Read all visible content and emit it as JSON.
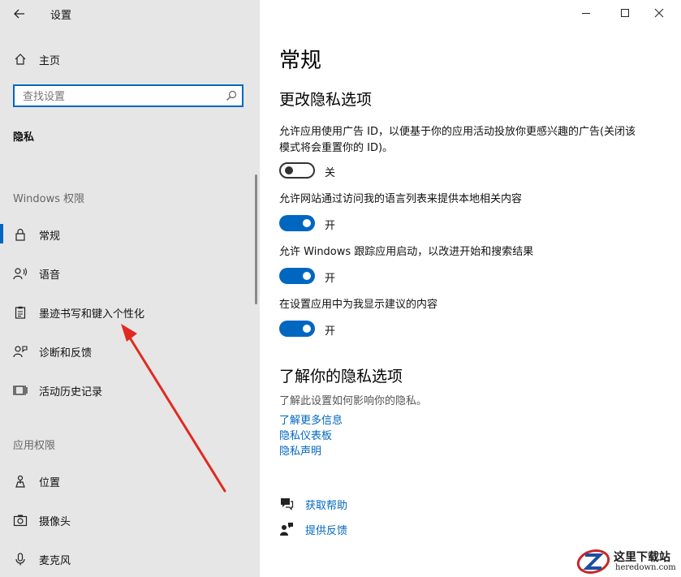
{
  "window": {
    "title": "设置"
  },
  "sidebar": {
    "home_label": "主页",
    "search": {
      "placeholder": "查找设置",
      "value": ""
    },
    "category_title": "隐私",
    "groups": [
      {
        "header": "Windows 权限",
        "items": [
          {
            "label": "常规",
            "icon": "lock-icon",
            "active": true
          },
          {
            "label": "语音",
            "icon": "speech-icon"
          },
          {
            "label": "墨迹书写和键入个性化",
            "icon": "clipboard-icon"
          },
          {
            "label": "诊断和反馈",
            "icon": "feedback-person-icon"
          },
          {
            "label": "活动历史记录",
            "icon": "timeline-icon"
          }
        ]
      },
      {
        "header": "应用权限",
        "items": [
          {
            "label": "位置",
            "icon": "location-icon"
          },
          {
            "label": "摄像头",
            "icon": "camera-icon"
          },
          {
            "label": "麦克风",
            "icon": "microphone-icon"
          }
        ]
      }
    ]
  },
  "main": {
    "page_title": "常规",
    "section1_title": "更改隐私选项",
    "settings": [
      {
        "desc": "允许应用使用广告 ID，以便基于你的应用活动投放你更感兴趣的广告(关闭该模式将会重置你的 ID)。",
        "state": "关",
        "on": false
      },
      {
        "desc": "允许网站通过访问我的语言列表来提供本地相关内容",
        "state": "开",
        "on": true
      },
      {
        "desc": "允许 Windows 跟踪应用启动，以改进开始和搜索结果",
        "state": "开",
        "on": true
      },
      {
        "desc": "在设置应用中为我显示建议的内容",
        "state": "开",
        "on": true
      }
    ],
    "section2_title": "了解你的隐私选项",
    "info_text": "了解此设置如何影响你的隐私。",
    "links": [
      "了解更多信息",
      "隐私仪表板",
      "隐私声明"
    ],
    "help": {
      "get_help": "获取帮助",
      "feedback": "提供反馈"
    }
  },
  "watermark": {
    "text": "这里下载站",
    "sub": "heredown.com"
  },
  "colors": {
    "accent": "#0067c0",
    "sidebar_bg": "#e6e6e6",
    "annotation_arrow": "#e02a20"
  }
}
